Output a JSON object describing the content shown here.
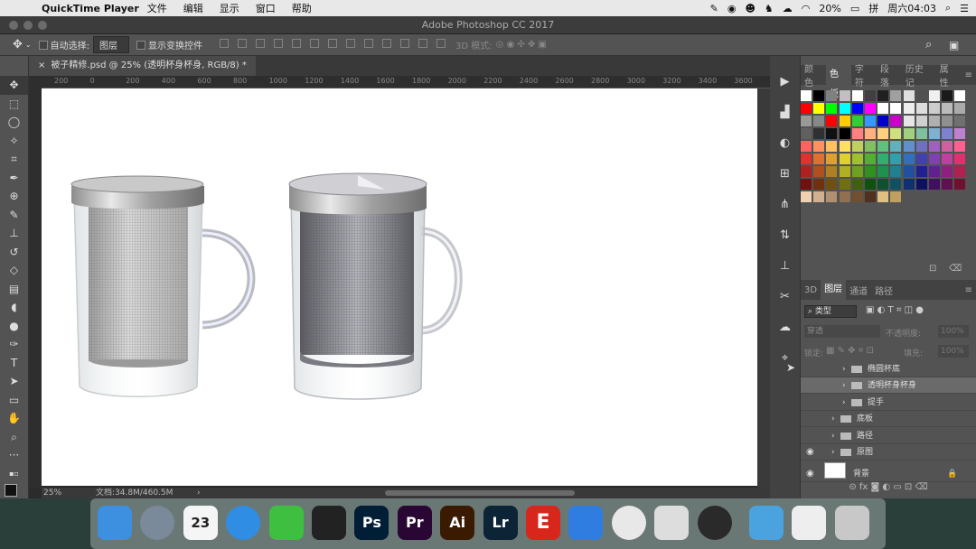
{
  "menubar": {
    "app_name": "QuickTime Player",
    "items": [
      "文件",
      "编辑",
      "显示",
      "窗口",
      "帮助"
    ],
    "battery": "20%",
    "clock": "周六04:03"
  },
  "window": {
    "title": "Adobe Photoshop CC 2017"
  },
  "options": {
    "auto_select_label": "自动选择:",
    "auto_select_value": "图层",
    "show_transform_label": "显示变换控件",
    "mode_3d_label": "3D 模式:"
  },
  "document": {
    "tab_label": "被子精修.psd @ 25% (透明杯身杯身, RGB/8) *",
    "zoom": "25%",
    "doc_size": "文档:34.8M/460.5M"
  },
  "ruler_ticks": [
    "200",
    "0",
    "200",
    "400",
    "600",
    "800",
    "1000",
    "1200",
    "1400",
    "1600",
    "1800",
    "2000",
    "2200",
    "2400",
    "2600",
    "2800",
    "3000",
    "3200",
    "3400",
    "3600",
    "3800",
    "4000"
  ],
  "panel_tabs_top": [
    "颜色",
    "色板",
    "字符",
    "段落",
    "历史记",
    "属性"
  ],
  "panel_tabs_layers": [
    "3D",
    "图层",
    "通道",
    "路径"
  ],
  "layers_filter": {
    "kind": "类型",
    "blend": "穿透",
    "opacity_label": "不透明度:",
    "opacity_value": "100%",
    "lock_label": "锁定:",
    "fill_label": "填充:",
    "fill_value": "100%"
  },
  "layers": [
    {
      "name": "椭圆杯底",
      "indent": 2,
      "visible": false
    },
    {
      "name": "透明杯身杯身",
      "indent": 2,
      "visible": false,
      "selected": true
    },
    {
      "name": "提手",
      "indent": 2,
      "visible": false
    },
    {
      "name": "底板",
      "indent": 1,
      "visible": false
    },
    {
      "name": "路径",
      "indent": 1,
      "visible": false
    },
    {
      "name": "原图",
      "indent": 1,
      "visible": true
    },
    {
      "name": "背景",
      "indent": 0,
      "visible": true,
      "locked": true
    }
  ],
  "dock": [
    {
      "name": "finder-icon",
      "label": "",
      "bg": "#3d8fe0"
    },
    {
      "name": "launchpad-icon",
      "label": "",
      "bg": "#7a8a9a"
    },
    {
      "name": "calendar-icon",
      "label": "23",
      "bg": "#f5f5f5"
    },
    {
      "name": "safari-icon",
      "label": "",
      "bg": "#2f8de4"
    },
    {
      "name": "wechat-icon",
      "label": "",
      "bg": "#3fbf3f"
    },
    {
      "name": "qq-icon",
      "label": "",
      "bg": "#222"
    },
    {
      "name": "photoshop-icon",
      "label": "Ps",
      "bg": "#001e36"
    },
    {
      "name": "premiere-icon",
      "label": "Pr",
      "bg": "#2a0634"
    },
    {
      "name": "illustrator-icon",
      "label": "Ai",
      "bg": "#3a1a00"
    },
    {
      "name": "lightroom-icon",
      "label": "Lr",
      "bg": "#0c2436"
    },
    {
      "name": "e-app-icon",
      "label": "E",
      "bg": "#d9261c"
    },
    {
      "name": "baidu-icon",
      "label": "",
      "bg": "#2f7de0"
    },
    {
      "name": "chrome-icon",
      "label": "",
      "bg": "#e8e8e8"
    },
    {
      "name": "feather-icon",
      "label": "",
      "bg": "#ddd"
    },
    {
      "name": "quicktime-icon",
      "label": "",
      "bg": "#2a2a2a"
    },
    {
      "name": "downloads-icon",
      "label": "",
      "bg": "#4aa3df"
    },
    {
      "name": "preview-icon",
      "label": "",
      "bg": "#eee"
    },
    {
      "name": "trash-icon",
      "label": "",
      "bg": "#c8c8c8"
    }
  ],
  "swatch_colors": [
    "#ffffff",
    "#000000",
    "#808080",
    "#c0c0c0",
    "#ffffff",
    "#404040",
    "#202020",
    "#a0a0a0",
    "#e0e0e0",
    "#505050",
    "#f0f0f0",
    "#1a1a1a",
    "#ffffff",
    "#ff0000",
    "#ffff00",
    "#00ff00",
    "#00ffff",
    "#0000ff",
    "#ff00ff",
    "#ffffff",
    "#ffffff",
    "#eeeeee",
    "#dddddd",
    "#cccccc",
    "#bbbbbb",
    "#aaaaaa",
    "#999999",
    "#888888",
    "#ff0000",
    "#ffcc00",
    "#33cc33",
    "#3399ff",
    "#0000cc",
    "#cc00cc",
    "#e6e6e6",
    "#d0d0d0",
    "#b0b0b0",
    "#909090",
    "#707070",
    "#606060",
    "#303030",
    "#101010",
    "#000000",
    "#ff8080",
    "#ffb080",
    "#ffd080",
    "#d0e080",
    "#a0d080",
    "#80c0a0",
    "#80b0d0",
    "#8080d0",
    "#c080d0",
    "#ff6060",
    "#ff9060",
    "#ffc060",
    "#ffe060",
    "#c0d060",
    "#80c060",
    "#60c080",
    "#60b0c0",
    "#6090d0",
    "#7070c0",
    "#a060c0",
    "#d060a0",
    "#ff6090",
    "#e03030",
    "#e07030",
    "#e0a030",
    "#e0d030",
    "#a0c030",
    "#50b030",
    "#30b070",
    "#30a0b0",
    "#3070c0",
    "#4040b0",
    "#8040b0",
    "#c040a0",
    "#e03070",
    "#b02020",
    "#b05020",
    "#b08020",
    "#b0b020",
    "#70a020",
    "#309020",
    "#209050",
    "#208090",
    "#2050a0",
    "#202090",
    "#602090",
    "#902080",
    "#b02050",
    "#701010",
    "#703010",
    "#705010",
    "#707010",
    "#406010",
    "#105010",
    "#105030",
    "#105060",
    "#103070",
    "#101060",
    "#401060",
    "#601050",
    "#701030",
    "#f0d0b0",
    "#d0b090",
    "#b09070",
    "#907050",
    "#705030",
    "#503020",
    "#e0c080",
    "#c0a060"
  ]
}
